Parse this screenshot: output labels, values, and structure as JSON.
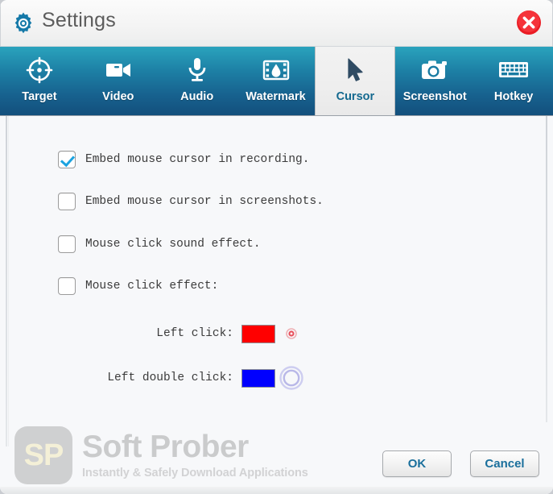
{
  "window": {
    "title": "Settings",
    "gear_icon": "gear-icon",
    "close_icon": "close-icon",
    "close_glyph": "✕"
  },
  "tabs": [
    {
      "label": "Target",
      "icon": "target-icon",
      "active": false
    },
    {
      "label": "Video",
      "icon": "video-camera-icon",
      "active": false
    },
    {
      "label": "Audio",
      "icon": "microphone-icon",
      "active": false
    },
    {
      "label": "Watermark",
      "icon": "watermark-film-icon",
      "active": false
    },
    {
      "label": "Cursor",
      "icon": "mouse-pointer-icon",
      "active": true
    },
    {
      "label": "Screenshot",
      "icon": "camera-icon",
      "active": false
    },
    {
      "label": "Hotkey",
      "icon": "keyboard-icon",
      "active": false
    }
  ],
  "cursor_panel": {
    "checkboxes": [
      {
        "label": "Embed mouse cursor in recording.",
        "checked": true
      },
      {
        "label": "Embed mouse cursor in screenshots.",
        "checked": false
      },
      {
        "label": "Mouse click sound effect.",
        "checked": false
      },
      {
        "label": "Mouse click effect:",
        "checked": false
      }
    ],
    "colors": [
      {
        "label": "Left click:",
        "color": "#FF0000",
        "preview": "small-dot-ring"
      },
      {
        "label": "Left double click:",
        "color": "#0000FF",
        "preview": "double-ring"
      }
    ],
    "preview_colors": {
      "left_click_ring": "#e8505c",
      "double_click_ring": "#b9b8e8"
    }
  },
  "footer": {
    "ok_label": "OK",
    "cancel_label": "Cancel"
  },
  "watermark": {
    "badge": "SP",
    "title": "Soft Prober",
    "tagline": "Instantly & Safely Download Applications"
  }
}
